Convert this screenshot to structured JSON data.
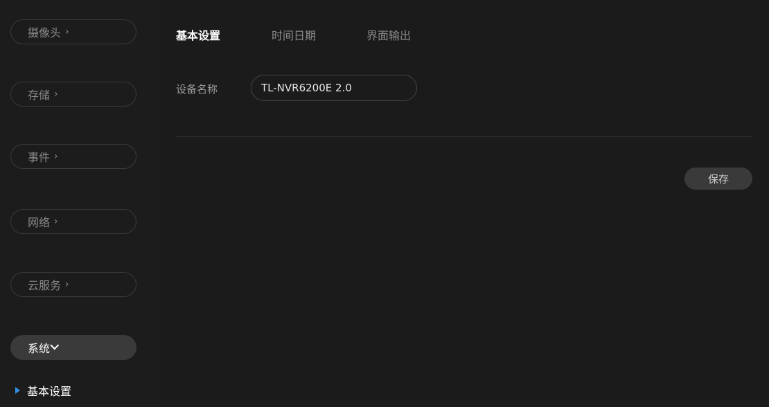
{
  "sidebar": {
    "items": [
      {
        "label": "摄像头",
        "chevron": "›"
      },
      {
        "label": "存储",
        "chevron": "›"
      },
      {
        "label": "事件",
        "chevron": "›"
      },
      {
        "label": "网络",
        "chevron": "›"
      },
      {
        "label": "云服务",
        "chevron": "›"
      },
      {
        "label": "系统",
        "expanded": true
      }
    ],
    "sub_items": [
      {
        "label": "基本设置",
        "active": true
      }
    ]
  },
  "tabs": [
    {
      "label": "基本设置",
      "active": true
    },
    {
      "label": "时间日期",
      "active": false
    },
    {
      "label": "界面输出",
      "active": false
    }
  ],
  "form": {
    "device_name_label": "设备名称",
    "device_name_value": "TL-NVR6200E 2.0"
  },
  "actions": {
    "save_label": "保存"
  },
  "colors": {
    "background": "#1b1b1b",
    "pill_border": "#3a3a3a",
    "active_pill": "#3a3a3a",
    "accent": "#2f8ee5"
  }
}
